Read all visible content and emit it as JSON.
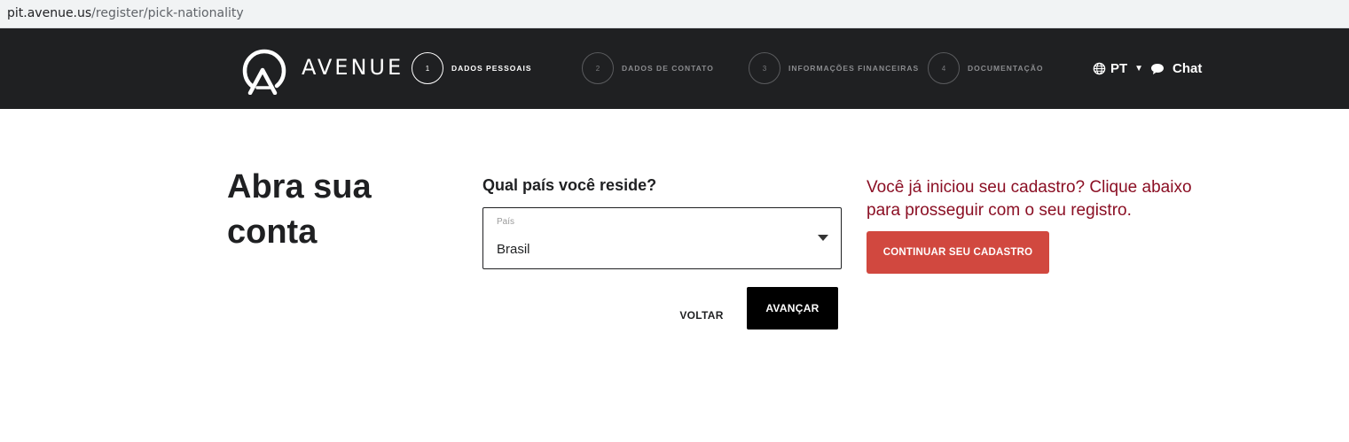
{
  "browser": {
    "url_host": "pit.avenue.us",
    "url_path": "/register/pick-nationality"
  },
  "header": {
    "brand": "AVENUE",
    "steps": [
      {
        "number": "1",
        "label": "DADOS PESSOAIS",
        "active": true
      },
      {
        "number": "2",
        "label": "DADOS DE CONTATO",
        "active": false
      },
      {
        "number": "3",
        "label": "INFORMAÇÕES FINANCEIRAS",
        "active": false
      },
      {
        "number": "4",
        "label": "DOCUMENTAÇÃO",
        "active": false
      }
    ],
    "language": "PT",
    "chat_label": "Chat",
    "icons": {
      "language": "globe-icon",
      "language_toggle": "caret-down-icon",
      "chat": "chat-bubble-icon"
    }
  },
  "main": {
    "title_line1": "Abra sua",
    "title_line2": "conta",
    "question": "Qual país você reside?",
    "country_field": {
      "label": "País",
      "value": "Brasil"
    },
    "back_label": "VOLTAR",
    "next_label": "AVANÇAR"
  },
  "resume": {
    "text": "Você já iniciou seu cadastro? Clique abaixo para prosseguir com o seu registro.",
    "button_label": "CONTINUAR SEU CADASTRO"
  },
  "colors": {
    "header_bg": "#1f2022",
    "notice_text": "#8b0f24",
    "continue_button": "#d1483f",
    "next_button": "#000000"
  }
}
